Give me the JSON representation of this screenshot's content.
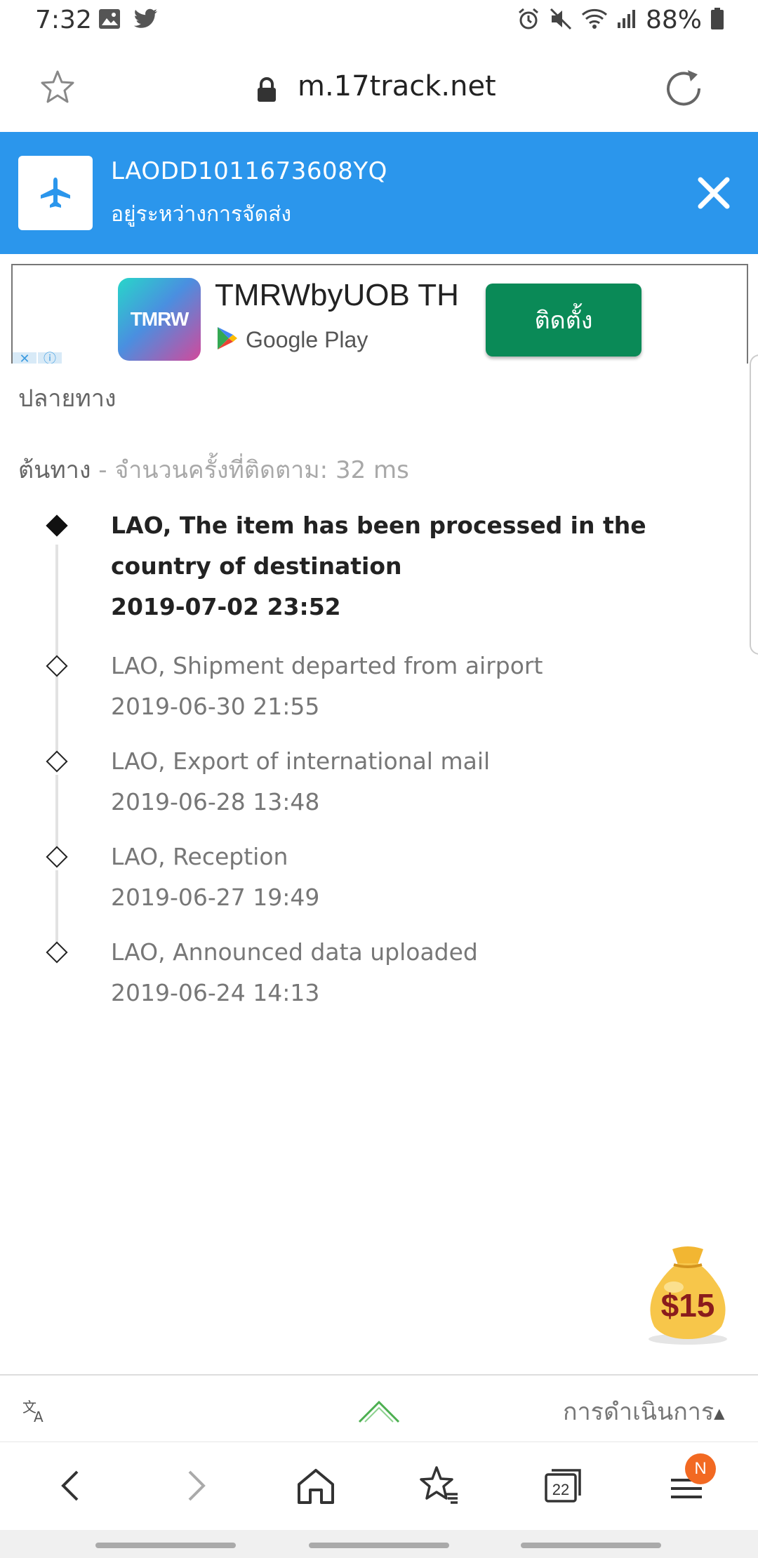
{
  "status_bar": {
    "time": "7:32",
    "battery": "88%",
    "left_icons": [
      "image-icon",
      "twitter-icon"
    ],
    "right_icons": [
      "alarm-icon",
      "mute-icon",
      "wifi-icon",
      "signal-icon",
      "battery-icon"
    ]
  },
  "browser": {
    "url": "m.17track.net",
    "tab_count": "22"
  },
  "tracking": {
    "number": "LAODD1011673608YQ",
    "status": "อยู่ระหว่างการจัดส่ง"
  },
  "ad": {
    "app_name": "TMRWbyUOB TH",
    "logo_text": "TMRW",
    "store": "Google Play",
    "install_label": "ติดตั้ง"
  },
  "content": {
    "destination_label": "ปลายทาง",
    "origin_label": "ต้นทาง",
    "origin_meta": " - จำนวนครั้งที่ติดตาม: 32 ms"
  },
  "events": [
    {
      "desc": "LAO, The item has been processed in the country of destination",
      "time": "2019-07-02 23:52"
    },
    {
      "desc": "LAO, Shipment departed from airport",
      "time": "2019-06-30 21:55"
    },
    {
      "desc": "LAO, Export of international mail",
      "time": "2019-06-28 13:48"
    },
    {
      "desc": "LAO, Reception",
      "time": "2019-06-27 19:49"
    },
    {
      "desc": "LAO, Announced data uploaded",
      "time": "2019-06-24 14:13"
    }
  ],
  "promo": {
    "amount": "$15"
  },
  "toolbar": {
    "actions_label": "การดำเนินการ"
  },
  "nav": {
    "badge": "N"
  },
  "colors": {
    "header_blue": "#2b96ec",
    "install_green": "#0a8a57",
    "badge_orange": "#f26922"
  }
}
